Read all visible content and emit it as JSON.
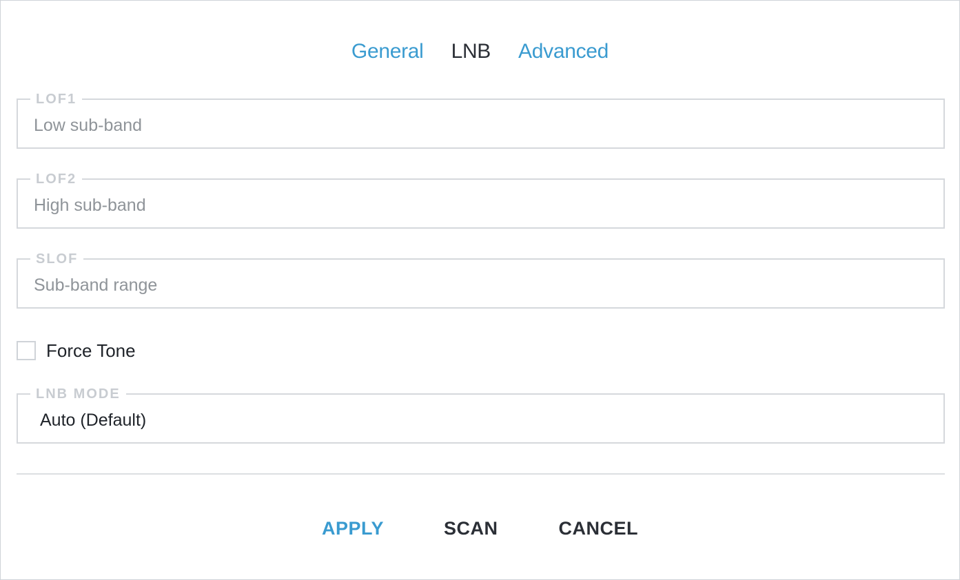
{
  "tabs": [
    {
      "label": "General",
      "active": false
    },
    {
      "label": "LNB",
      "active": true
    },
    {
      "label": "Advanced",
      "active": false
    }
  ],
  "fields": {
    "lof1": {
      "legend": "LOF1",
      "placeholder": "Low sub-band",
      "value": ""
    },
    "lof2": {
      "legend": "LOF2",
      "placeholder": "High sub-band",
      "value": ""
    },
    "slof": {
      "legend": "SLOF",
      "placeholder": "Sub-band range",
      "value": ""
    }
  },
  "force_tone": {
    "label": "Force Tone",
    "checked": false
  },
  "lnb_mode": {
    "legend": "LNB MODE",
    "selected": "Auto (Default)"
  },
  "actions": {
    "apply": "APPLY",
    "scan": "SCAN",
    "cancel": "CANCEL"
  },
  "colors": {
    "accent": "#3a9bd0",
    "text": "#1f2329",
    "legend": "#c8ccd1",
    "border": "#d5d8dc"
  }
}
